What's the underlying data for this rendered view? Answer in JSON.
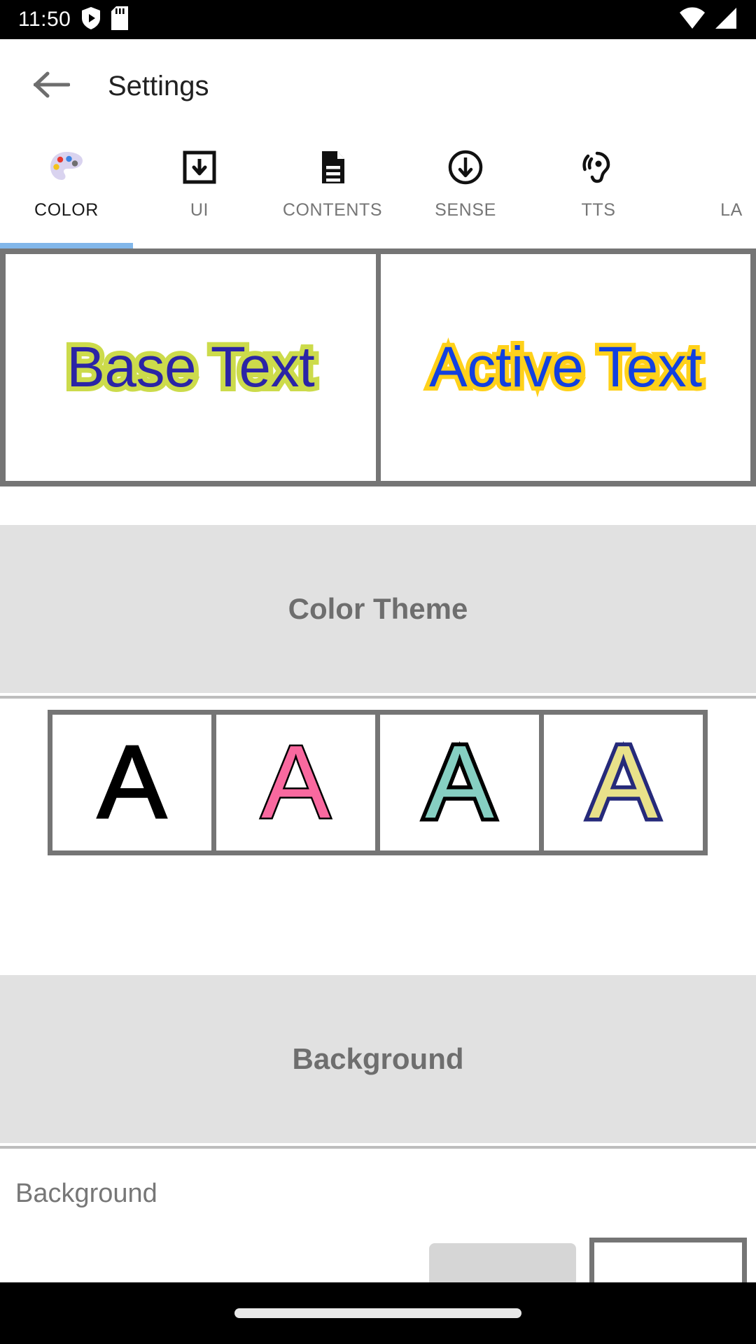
{
  "statusbar": {
    "time": "11:50",
    "icons": [
      "shield-play-icon",
      "sd-card-icon"
    ],
    "right_icons": [
      "wifi-icon",
      "cell-signal-icon"
    ]
  },
  "appbar": {
    "back_icon": "arrow-left-icon",
    "title": "Settings"
  },
  "tabs": {
    "active_index": 0,
    "active_color": "#82b7ea",
    "items": [
      {
        "label": "COLOR",
        "icon": "palette-icon"
      },
      {
        "label": "UI",
        "icon": "box-download-icon"
      },
      {
        "label": "CONTENTS",
        "icon": "document-icon"
      },
      {
        "label": "SENSE",
        "icon": "circle-down-arrow-icon"
      },
      {
        "label": "TTS",
        "icon": "ear-hearing-icon"
      },
      {
        "label": "LA",
        "icon": "language-icon"
      }
    ]
  },
  "preview": {
    "base": {
      "text": "Base Text",
      "fill": "#2b24a6",
      "stroke": "#ccdb4b"
    },
    "active": {
      "text": "Active Text",
      "fill": "#1140e0",
      "stroke": "#ffd11a"
    }
  },
  "sections": {
    "color_theme": {
      "title": "Color Theme",
      "swatches": [
        {
          "letter": "A",
          "fill": "#000000",
          "stroke": "#000000"
        },
        {
          "letter": "A",
          "fill": "#f9699f",
          "stroke": "#000000"
        },
        {
          "letter": "A",
          "fill": "#86cfc2",
          "stroke": "#000000"
        },
        {
          "letter": "A",
          "fill": "#e9e18a",
          "stroke": "#262a7a"
        }
      ]
    },
    "background": {
      "title": "Background",
      "row_label": "Background",
      "button_color": "#d6d6d6",
      "chip_color": "#ffffff"
    }
  },
  "navbar": {
    "home_pill": "home-indicator"
  }
}
